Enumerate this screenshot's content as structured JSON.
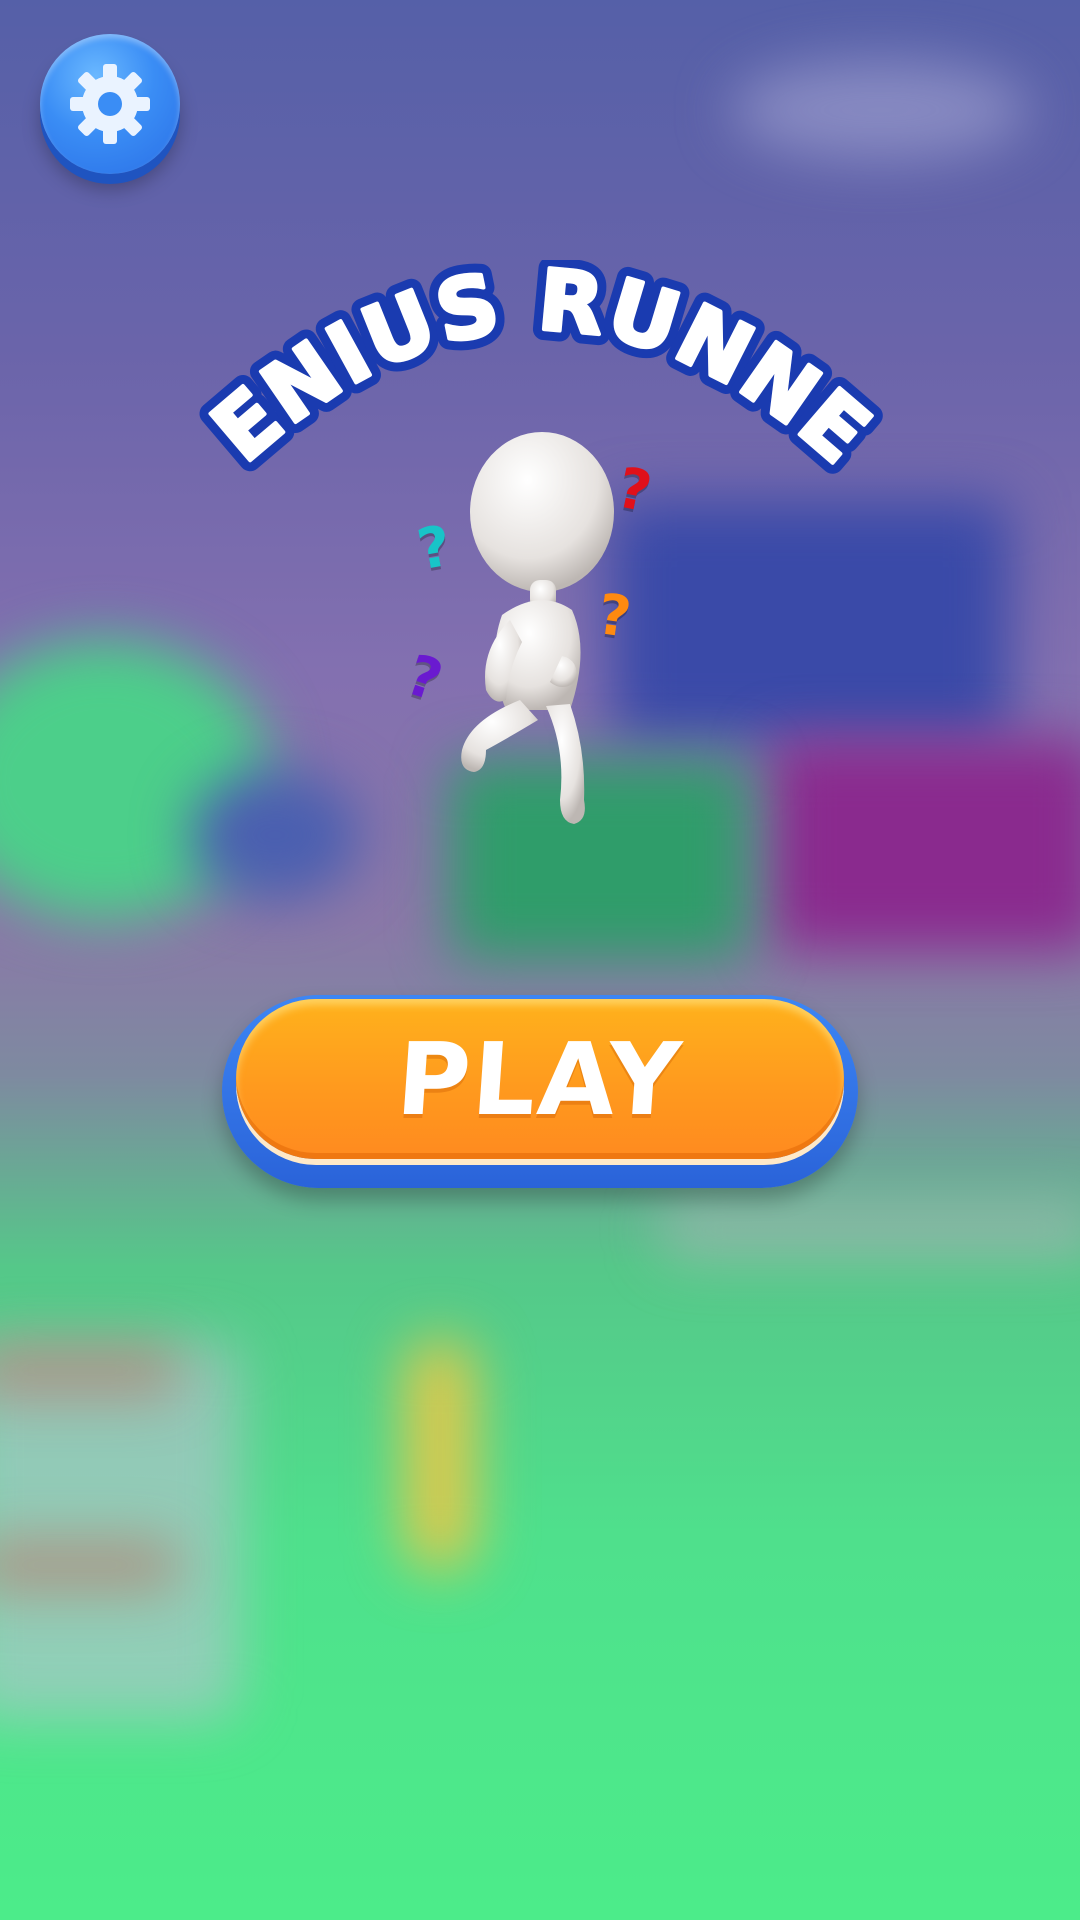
{
  "game": {
    "title": "GENIUS RUNNER",
    "play_label": "PLAY"
  },
  "icons": {
    "settings": "gear-icon"
  },
  "decorations": {
    "question_marks": [
      {
        "char": "?",
        "color": "#e0101a"
      },
      {
        "char": "?",
        "color": "#18c4c8"
      },
      {
        "char": "?",
        "color": "#ff8a10"
      },
      {
        "char": "?",
        "color": "#6a1ad0"
      }
    ]
  },
  "colors": {
    "play_orange": "#ff9a1e",
    "button_blue": "#3a8df5",
    "title_outline": "#1a3bb0"
  }
}
